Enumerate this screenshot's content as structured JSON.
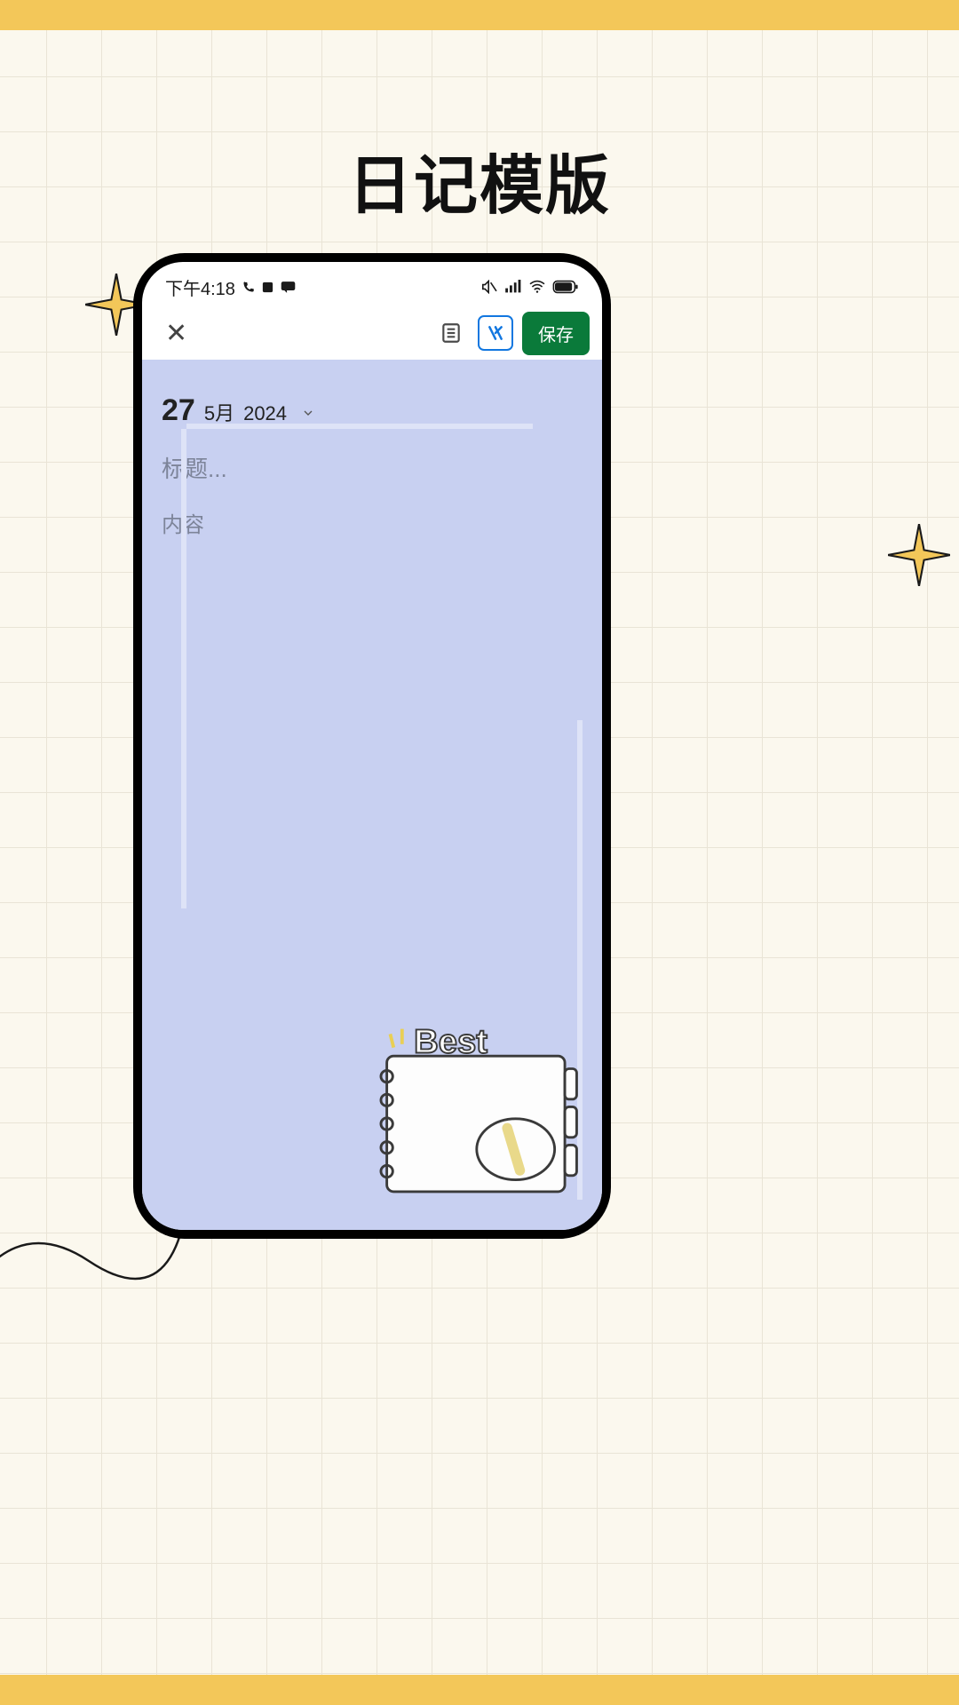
{
  "page": {
    "title": "日记模版"
  },
  "status": {
    "time": "下午4:18",
    "icons_left": [
      "call-icon",
      "app-icon",
      "message-icon"
    ],
    "icons_right": [
      "mute-icon",
      "signal-icon",
      "wifi-icon",
      "battery-icon"
    ]
  },
  "toolbar": {
    "close_label": "✕",
    "list_icon": "template-list-icon",
    "theme_icon": "theme-icon",
    "save_label": "保存"
  },
  "editor": {
    "date": {
      "day": "27",
      "month": "5月",
      "year": "2024"
    },
    "title_placeholder": "标题...",
    "content_placeholder": "内容",
    "decoration_label": "Best"
  },
  "colors": {
    "accent_green": "#0a7a3a",
    "accent_blue": "#1277e0",
    "editor_bg": "#c8d0f1",
    "page_bg": "#fbf8ee",
    "bar_yellow": "#f3c759"
  }
}
